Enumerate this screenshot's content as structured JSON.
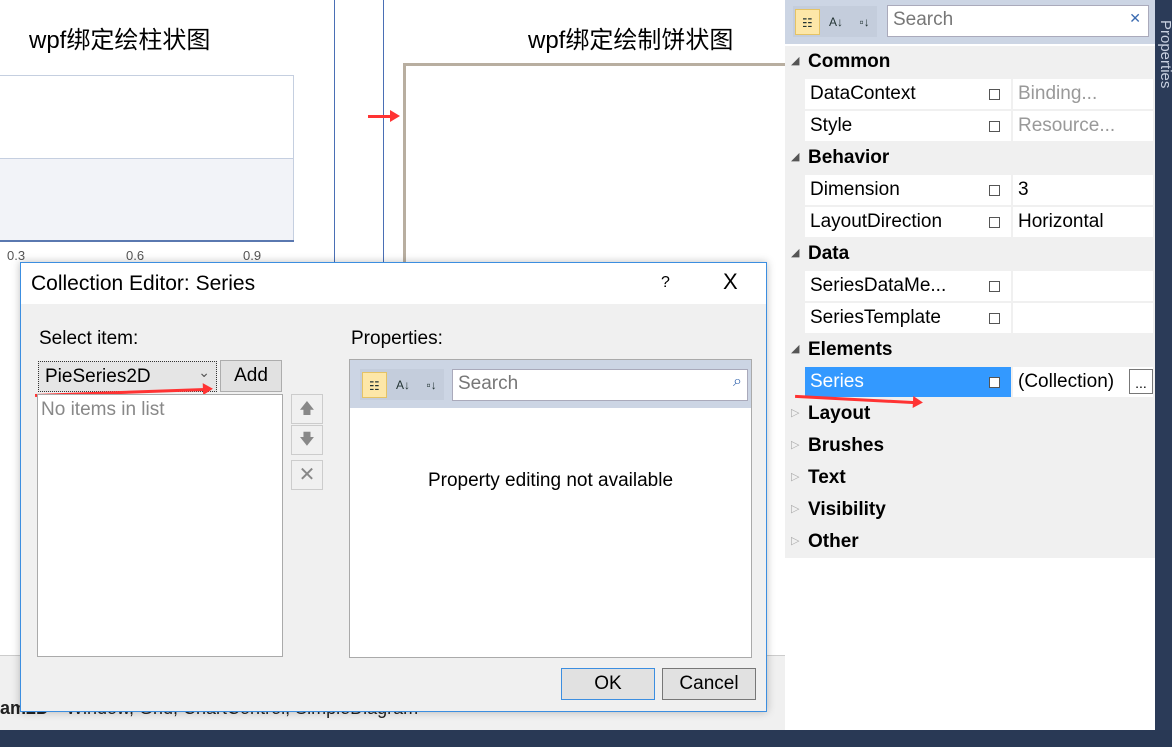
{
  "designer": {
    "bar_chart_title": "wpf绑定绘柱状图",
    "bar_axis_ticks": [
      "0.3",
      "0.6",
      "0.9"
    ],
    "pie_chart_title": "wpf绑定绘制饼状图",
    "bottom_name": "am2D",
    "bottom_desc": "Window, Grid, ChartControl, SimpleDiagram"
  },
  "dialog": {
    "title": "Collection Editor: Series",
    "help": "?",
    "close": "X",
    "select_item_label": "Select item:",
    "combo_value": "PieSeries2D",
    "add_label": "Add",
    "list_empty": "No items in list",
    "properties_label": "Properties:",
    "search_placeholder": "Search",
    "no_props": "Property editing not available",
    "ok": "OK",
    "cancel": "Cancel"
  },
  "properties": {
    "search_placeholder": "Search",
    "side_tab": "Properties",
    "categories": [
      {
        "name": "Common",
        "expanded": true,
        "rows": [
          {
            "name": "DataContext",
            "value": "Binding...",
            "dim": true
          },
          {
            "name": "Style",
            "value": "Resource...",
            "dim": true
          }
        ]
      },
      {
        "name": "Behavior",
        "expanded": true,
        "rows": [
          {
            "name": "Dimension",
            "value": "3"
          },
          {
            "name": "LayoutDirection",
            "value": "Horizontal"
          }
        ]
      },
      {
        "name": "Data",
        "expanded": true,
        "rows": [
          {
            "name": "SeriesDataMe...",
            "value": ""
          },
          {
            "name": "SeriesTemplate",
            "value": ""
          }
        ]
      },
      {
        "name": "Elements",
        "expanded": true,
        "rows": [
          {
            "name": "Series",
            "value": "(Collection)",
            "selected": true,
            "ellipsis": "..."
          }
        ]
      },
      {
        "name": "Layout",
        "expanded": false,
        "rows": []
      },
      {
        "name": "Brushes",
        "expanded": false,
        "rows": []
      },
      {
        "name": "Text",
        "expanded": false,
        "rows": []
      },
      {
        "name": "Visibility",
        "expanded": false,
        "rows": []
      },
      {
        "name": "Other",
        "expanded": false,
        "rows": []
      }
    ]
  },
  "colors": {
    "selection": "#3399ff",
    "annotation_arrow": "#ff3333",
    "dialog_border": "#3c8ee0"
  }
}
